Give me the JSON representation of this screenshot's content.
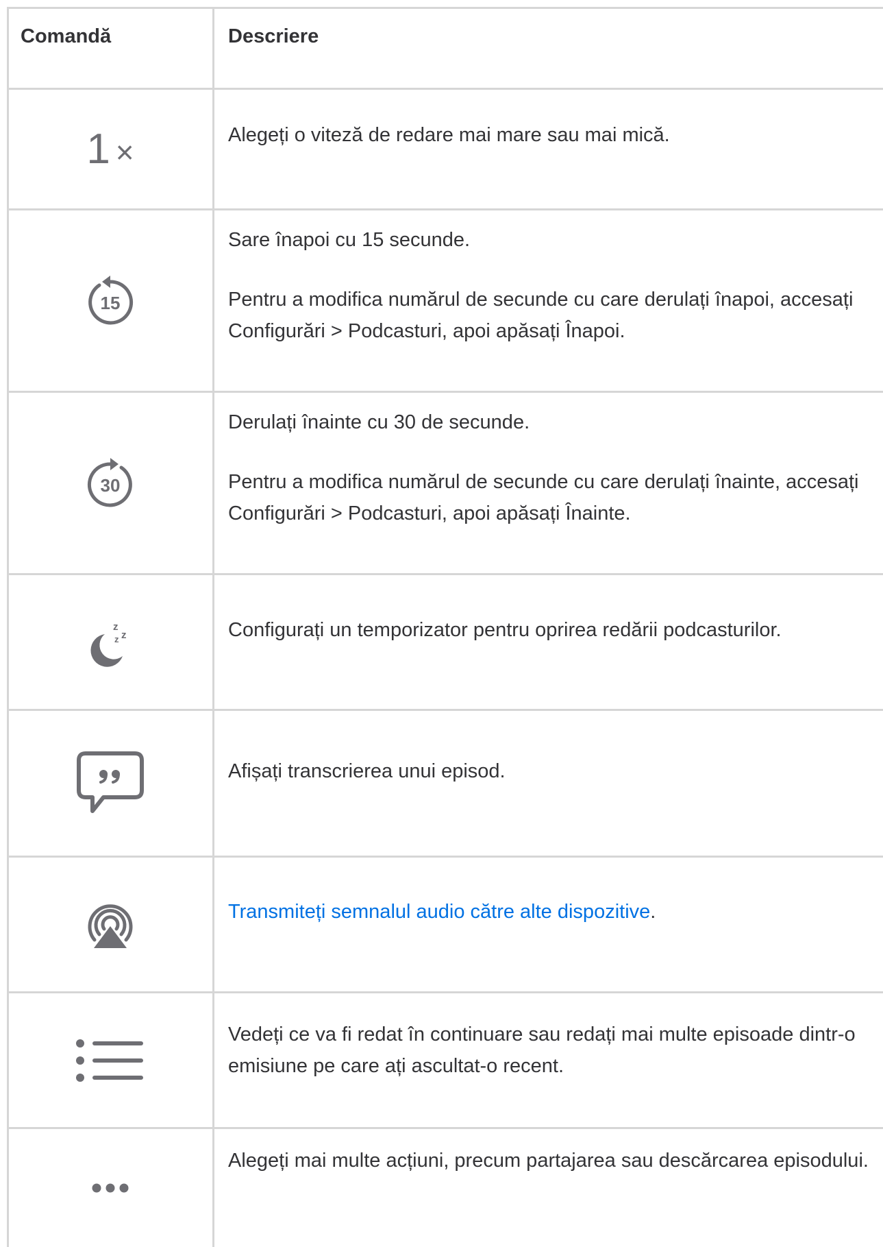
{
  "header": {
    "col_command": "Comandă",
    "col_description": "Descriere"
  },
  "rows": [
    {
      "icon": "playback-speed-icon",
      "icon_text": "1×",
      "paragraphs": [
        "Alegeți o viteză de redare mai mare sau mai mică."
      ]
    },
    {
      "icon": "skip-back-15-icon",
      "icon_text": "15",
      "paragraphs": [
        "Sare înapoi cu 15 secunde.",
        "Pentru a modifica numărul de secunde cu care derulați înapoi, accesați Configurări > Podcasturi, apoi apăsați Înapoi."
      ]
    },
    {
      "icon": "skip-forward-30-icon",
      "icon_text": "30",
      "paragraphs": [
        "Derulați înainte cu 30 de secunde.",
        "Pentru a modifica numărul de secunde cu care derulați înainte, accesați Configurări > Podcasturi, apoi apăsați Înainte."
      ]
    },
    {
      "icon": "sleep-timer-moon-icon",
      "paragraphs": [
        "Configurați un temporizator pentru oprirea redării podcasturilor."
      ]
    },
    {
      "icon": "transcript-quote-bubble-icon",
      "paragraphs": [
        "Afișați transcrierea unui episod."
      ]
    },
    {
      "icon": "airplay-audio-icon",
      "link_text": "Transmiteți semnalul audio către alte dispozitive",
      "after_link": "."
    },
    {
      "icon": "up-next-list-icon",
      "paragraphs": [
        "Vedeți ce va fi redat în continuare sau redați mai multe episoade dintr-o emisiune pe care ați ascultat-o recent."
      ]
    },
    {
      "icon": "more-ellipsis-icon",
      "paragraphs": [
        "Alegeți mai multe acțiuni, precum partajarea sau descărcarea episodului."
      ]
    }
  ],
  "colors": {
    "text": "#333336",
    "icon": "#6e6e73",
    "border": "#d6d6d6",
    "link": "#0071e3"
  }
}
